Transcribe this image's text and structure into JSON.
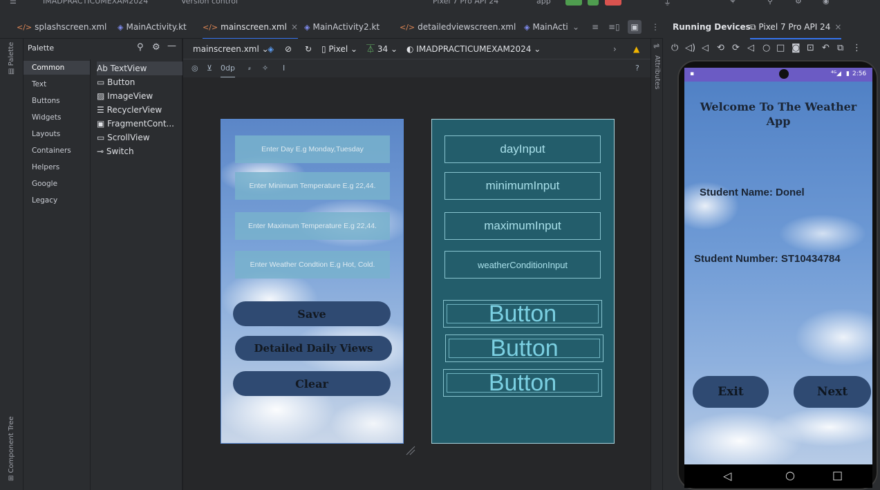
{
  "titlebar": {
    "project": "IMADPRACTICUMEXAM2024",
    "vcs": "Version control",
    "device": "Pixel 7 Pro API 24",
    "run_config": "app"
  },
  "editor_tabs": [
    {
      "label": "splashscreen.xml",
      "type": "xml"
    },
    {
      "label": "MainActivity.kt",
      "type": "kt"
    },
    {
      "label": "mainscreen.xml",
      "type": "xml",
      "active": true
    },
    {
      "label": "MainActivity2.kt",
      "type": "kt"
    },
    {
      "label": "detailedviewscreen.xml",
      "type": "xml"
    },
    {
      "label": "MainActi",
      "type": "kt"
    }
  ],
  "left_strip": {
    "palette": "Palette",
    "component_tree": "Component Tree"
  },
  "palette": {
    "title": "Palette",
    "categories": [
      "Common",
      "Text",
      "Buttons",
      "Widgets",
      "Layouts",
      "Containers",
      "Helpers",
      "Google",
      "Legacy"
    ],
    "components": [
      {
        "icon": "Ab",
        "label": "TextView"
      },
      {
        "icon": "▭",
        "label": "Button"
      },
      {
        "icon": "▨",
        "label": "ImageView"
      },
      {
        "icon": "☰",
        "label": "RecyclerView"
      },
      {
        "icon": "▣",
        "label": "FragmentCont..."
      },
      {
        "icon": "▭",
        "label": "ScrollView"
      },
      {
        "icon": "⊸",
        "label": "Switch"
      }
    ]
  },
  "design_toolbar": {
    "file": "mainscreen.xml",
    "device": "Pixel",
    "api": "34",
    "theme": "IMADPRACTICUMEXAM2024",
    "margin": "0dp",
    "help": "?"
  },
  "attributes_label": "Attributes",
  "design_preview": {
    "inputs": [
      "Enter Day E.g Monday,Tuesday",
      "Enter Minimum Temperature E.g 22,44.",
      "Enter Maximum Temperature E.g 22,44.",
      "Enter Weather Condtion E.g Hot, Cold."
    ],
    "buttons": [
      "Save",
      "Detailed Daily Views",
      "Clear"
    ]
  },
  "blueprint": {
    "inputs": [
      "dayInput",
      "minimumInput",
      "maximumInput",
      "weatherConditionInput"
    ],
    "buttons": [
      "Button",
      "Button",
      "Button"
    ]
  },
  "running_devices": {
    "title": "Running Devices",
    "device_tab": "Pixel 7 Pro API 24"
  },
  "emulator": {
    "time": "2:56",
    "welcome": "Welcome To The Weather App",
    "student_name": "Student Name: Donel",
    "student_number": "Student Number: ST10434784",
    "buttons": [
      "Exit",
      "Next"
    ]
  },
  "colors": {
    "accent": "#3574f0",
    "blueprint_bg": "#235d6b",
    "app_button": "#2f4a72",
    "status_bar": "#6b5bc4"
  }
}
